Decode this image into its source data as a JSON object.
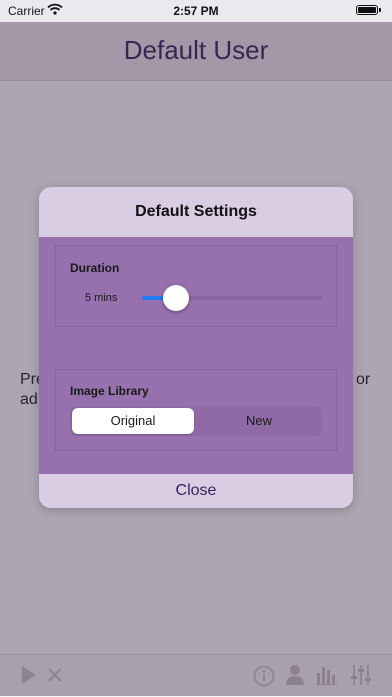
{
  "status_bar": {
    "carrier": "Carrier",
    "time": "2:57 PM"
  },
  "nav": {
    "title": "Default User"
  },
  "background": {
    "line1_left": "Pre",
    "line1_right": "or",
    "line2": "ad"
  },
  "toolbar": {
    "icons": [
      "play-icon",
      "close-icon",
      "info-icon",
      "user-icon",
      "bar-chart-icon",
      "sliders-icon"
    ]
  },
  "dialog": {
    "title": "Default Settings",
    "duration": {
      "label": "Duration",
      "value_text": "5 mins",
      "slider_fraction": 0.19
    },
    "image_library": {
      "label": "Image Library",
      "options": [
        "Original",
        "New"
      ],
      "selected": "Original"
    },
    "close_label": "Close"
  },
  "colors": {
    "accent": "#1f7cf2",
    "title_purple": "#3b1f5c",
    "dialog_body": "#9771ad",
    "dialog_header": "#d9cde3"
  }
}
